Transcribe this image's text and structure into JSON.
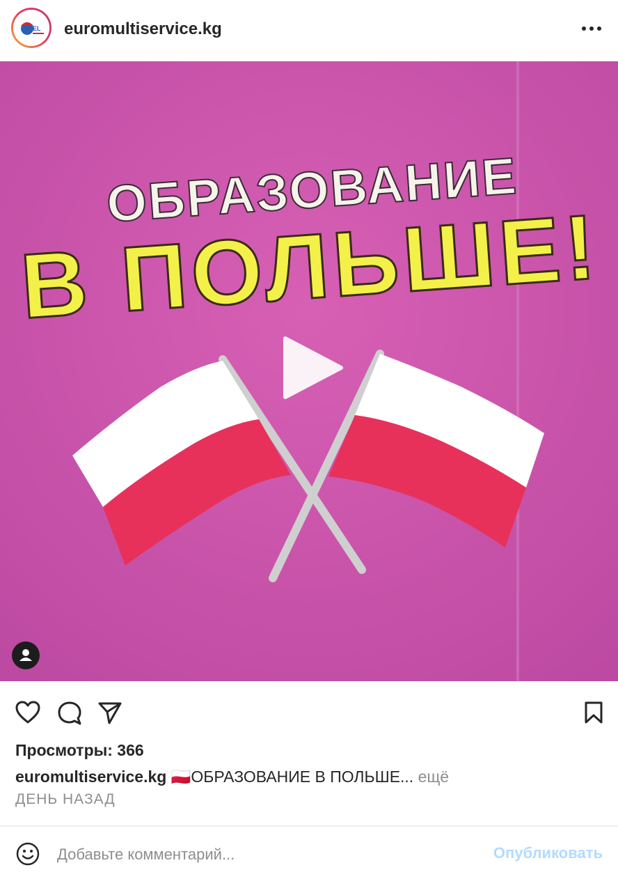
{
  "header": {
    "username": "euromultiservice.kg",
    "avatar_icon": "euromultiservice-logo",
    "more_icon": "more-horizontal-icon"
  },
  "post": {
    "headline_line1": "ОБРАЗОВАНИЕ",
    "headline_line2": "В ПОЛЬШЕ!",
    "background_color": "#c84ea8",
    "headline_line2_color": "#f3f04a",
    "flag_colors": [
      "#ffffff",
      "#e8315a"
    ],
    "play_icon": "play-icon",
    "tagged_users_icon": "user-icon"
  },
  "actions": {
    "like_icon": "heart-icon",
    "comment_icon": "comment-icon",
    "share_icon": "send-icon",
    "save_icon": "bookmark-icon"
  },
  "stats": {
    "views_label": "Просмотры: 366"
  },
  "caption": {
    "username": "euromultiservice.kg",
    "flag_emoji": "🇵🇱",
    "text": "ОБРАЗОВАНИЕ В ПОЛЬШЕ...",
    "more_label": "ещё"
  },
  "timestamp": "ДЕНЬ НАЗАД",
  "comment": {
    "emoji_icon": "smiley-icon",
    "placeholder": "Добавьте комментарий...",
    "publish_label": "Опубликовать"
  }
}
